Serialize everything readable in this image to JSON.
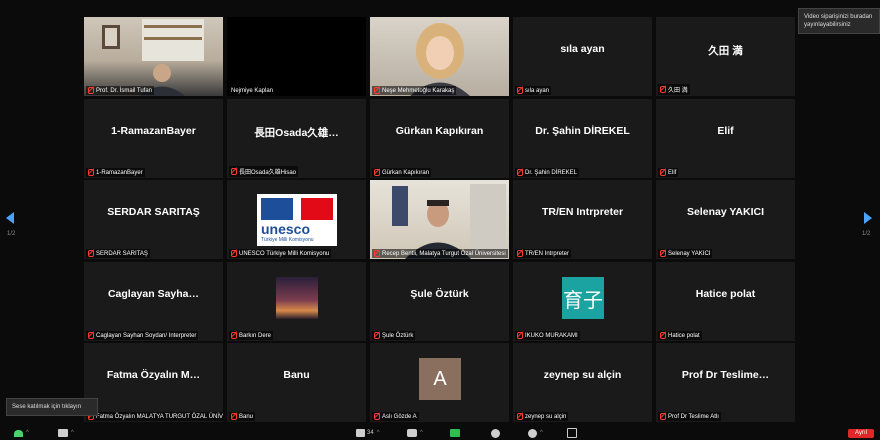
{
  "tooltips": {
    "recording": "Video siparişinizi buradan yayınlayabilirsiniz",
    "audio": "Sese katılmak için tıklayın"
  },
  "pagination": {
    "left": "1/2",
    "right": "1/2"
  },
  "tiles": [
    {
      "label": "Prof. Dr. İsmail Tufan",
      "type": "video",
      "scene": "office",
      "muted": true
    },
    {
      "label": "Nejmiye Kaplan",
      "type": "video",
      "scene": "black",
      "muted": false
    },
    {
      "label": "Neşe Mehmetoğlu Karakaş",
      "type": "video",
      "scene": "woman",
      "muted": true
    },
    {
      "name": "sıla ayan",
      "label": "sıla ayan",
      "type": "name",
      "muted": true
    },
    {
      "name": "久田 満",
      "label": "久田 満",
      "type": "name",
      "muted": true
    },
    {
      "name": "1-RamazanBayer",
      "label": "1-RamazanBayer",
      "type": "name",
      "muted": true
    },
    {
      "name": "長田Osada久雄…",
      "label": "長田Osada久雄Hisao",
      "type": "name",
      "muted": true
    },
    {
      "name": "Gürkan Kapıkıran",
      "label": "Gürkan Kapıkıran",
      "type": "name",
      "muted": true
    },
    {
      "name": "Dr. Şahin DİREKEL",
      "label": "Dr. Şahin DİREKEL",
      "type": "name",
      "muted": true
    },
    {
      "name": "Elif",
      "label": "Elif",
      "type": "name",
      "muted": true
    },
    {
      "name": "SERDAR SARITAŞ",
      "label": "SERDAR SARITAŞ",
      "type": "name",
      "muted": true
    },
    {
      "label": "UNESCO Türkiye Milli Komisyonu",
      "type": "unesco",
      "unesco_text": "unesco",
      "unesco_sub": "Türkiye Milli Komisyonu",
      "muted": true
    },
    {
      "label": "Recep Bentli, Malatya Turgut Özal Üniversitesi",
      "type": "video",
      "scene": "man",
      "speaking": true,
      "muted": true
    },
    {
      "name": "TR/EN Intrpreter",
      "label": "TR/EN Intrpreter",
      "type": "name",
      "muted": true
    },
    {
      "name": "Selenay YAKICI",
      "label": "Selenay YAKICI",
      "type": "name",
      "muted": true
    },
    {
      "name": "Caglayan Sayha…",
      "label": "Caglayan Sayhan Soydan/ Interpreter",
      "type": "name",
      "muted": true
    },
    {
      "label": "Barkın Dere",
      "type": "photo",
      "muted": true
    },
    {
      "name": "Şule Öztürk",
      "label": "Şule Öztürk",
      "type": "name",
      "muted": true
    },
    {
      "label": "IKUKO MURAKAMI",
      "type": "avatar",
      "avatar_text": "育子",
      "avatar_color": "#1aa3a0",
      "muted": true
    },
    {
      "name": "Hatice polat",
      "label": "Hatice polat",
      "type": "name",
      "muted": true
    },
    {
      "name": "Fatma Özyalın M…",
      "label": "Fatma Özyalın MALATYA TURGUT ÖZAL ÜNİVE…",
      "type": "name",
      "muted": true
    },
    {
      "name": "Banu",
      "label": "Banu",
      "type": "name",
      "muted": true
    },
    {
      "label": "Aslı Gözde A",
      "type": "avatar",
      "avatar_text": "A",
      "avatar_color": "#8a6f5e",
      "muted": true
    },
    {
      "name": "zeynep su alçin",
      "label": "zeynep su alçin",
      "type": "name",
      "muted": true
    },
    {
      "name": "Prof Dr Teslime…",
      "label": "Prof Dr Teslime Atlı",
      "type": "name",
      "muted": true
    }
  ],
  "toolbar": {
    "participants_count": "34",
    "end_label": "Ayrıl"
  }
}
